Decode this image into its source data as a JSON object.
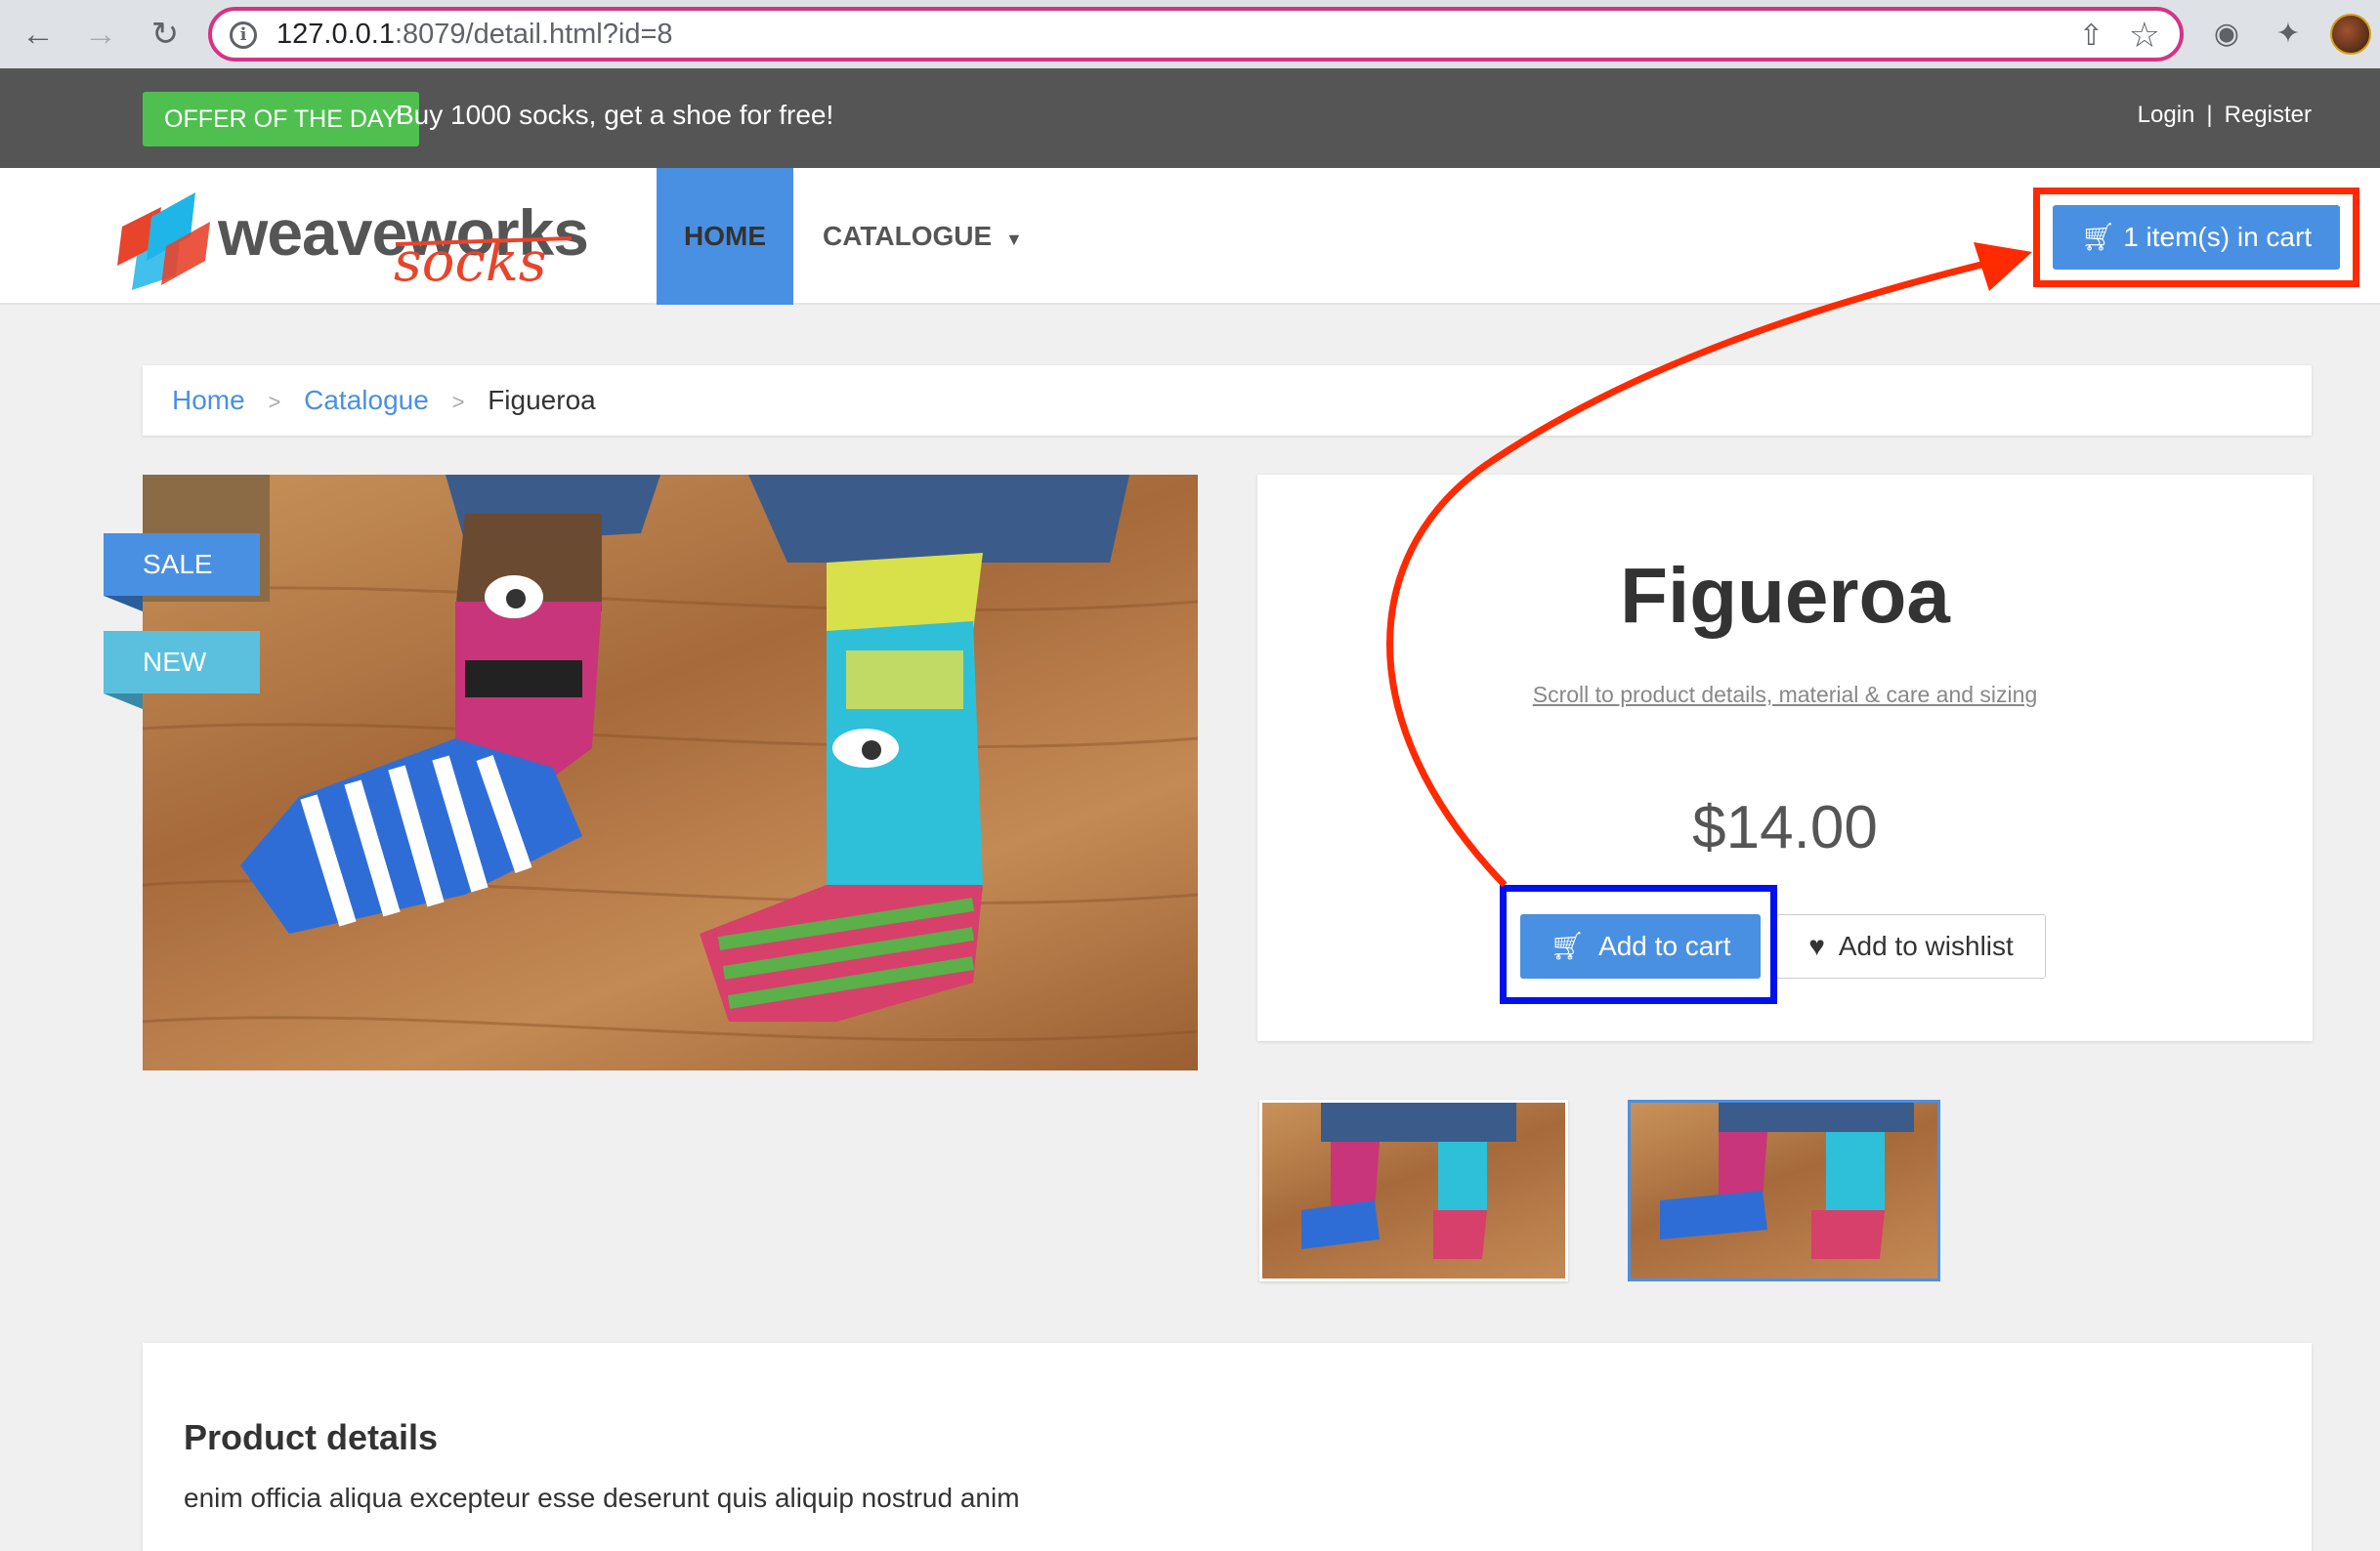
{
  "browser": {
    "url_host": "127.0.0.1",
    "url_rest": ":8079/detail.html?id=8",
    "back_icon": "arrow-left-icon",
    "forward_icon": "arrow-right-icon",
    "reload_icon": "reload-icon"
  },
  "topbar": {
    "offer_badge": "OFFER OF THE DAY",
    "offer_text": "Buy 1000 socks, get a shoe for free!",
    "login": "Login",
    "separator": "|",
    "register": "Register"
  },
  "navbar": {
    "logo_word_1": "weaveworks",
    "logo_word_2": "socks",
    "home": "HOME",
    "catalogue": "CATALOGUE",
    "cart": "1 item(s) in cart"
  },
  "breadcrumb": {
    "home": "Home",
    "catalogue": "Catalogue",
    "current": "Figueroa",
    "sep": ">"
  },
  "product": {
    "ribbon_sale": "SALE",
    "ribbon_new": "NEW",
    "title": "Figueroa",
    "scroll_link": "Scroll to product details, material & care and sizing",
    "price": "$14.00",
    "add_to_cart": "Add to cart",
    "add_to_wishlist": "Add to wishlist"
  },
  "details": {
    "title": "Product details",
    "text": "enim officia aliqua excepteur esse deserunt quis aliquip nostrud anim"
  },
  "colors": {
    "brand_blue": "#4a90e2",
    "offer_green": "#4fbf4f",
    "annotation_red": "#ff2a00",
    "annotation_blue": "#0011ee"
  }
}
